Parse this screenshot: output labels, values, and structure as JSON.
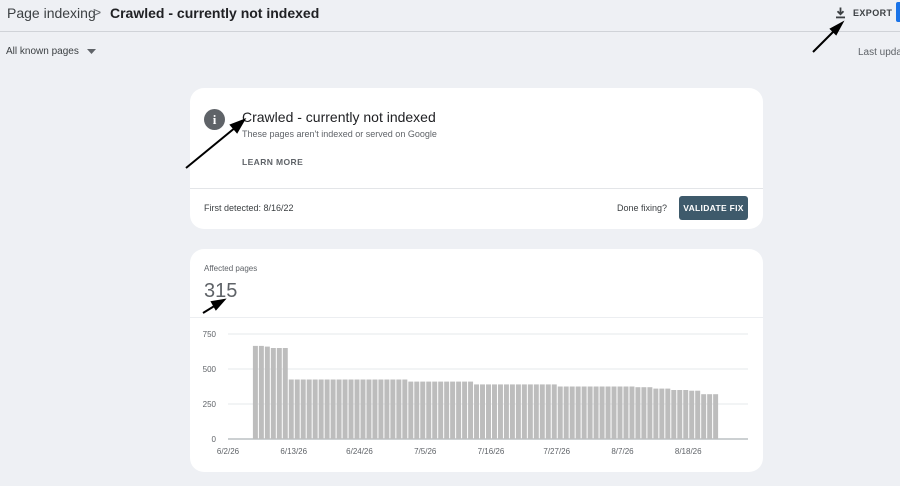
{
  "breadcrumb": {
    "parent": "Page indexing",
    "separator": ">",
    "current": "Crawled - currently not indexed"
  },
  "toolbar": {
    "export_label": "EXPORT",
    "export_icon": "download-icon",
    "last_updated_label": "Last upda"
  },
  "filter": {
    "selected": "All known pages",
    "icon": "dropdown-triangle-icon"
  },
  "status_card": {
    "icon": "info-icon",
    "title": "Crawled - currently not indexed",
    "subtitle": "These pages aren't indexed or served on Google",
    "learn_more_label": "LEARN MORE",
    "first_detected": "First detected: 8/16/22",
    "done_fixing_label": "Done fixing?",
    "validate_label": "VALIDATE FIX"
  },
  "affected_card": {
    "label": "Affected pages",
    "count": "315"
  },
  "colors": {
    "bar": "#bdbdbd",
    "validate_button": "#3e5a6b",
    "accent": "#1a73e8",
    "card": "#ffffff",
    "page_bg": "#eef0f4"
  },
  "chart_data": {
    "type": "bar",
    "ylim": [
      0,
      750
    ],
    "y_ticks": [
      0,
      250,
      500,
      750
    ],
    "x_tick_labels": [
      "6/2/26",
      "6/13/26",
      "6/24/26",
      "7/5/26",
      "7/16/26",
      "7/27/26",
      "8/7/26",
      "8/18/26"
    ],
    "x_tick_dates": [
      "2026-06-02",
      "2026-06-13",
      "2026-06-24",
      "2026-07-05",
      "2026-07-16",
      "2026-07-27",
      "2026-08-07",
      "2026-08-18"
    ],
    "date_start": "2026-06-02",
    "date_end": "2026-08-22",
    "grid": true,
    "series": [
      {
        "points": [
          [
            "2026-06-06",
            665
          ],
          [
            "2026-06-07",
            665
          ],
          [
            "2026-06-08",
            660
          ],
          [
            "2026-06-09",
            650
          ],
          [
            "2026-06-10",
            650
          ],
          [
            "2026-06-11",
            650
          ],
          [
            "2026-06-12",
            425
          ],
          [
            "2026-06-13",
            425
          ],
          [
            "2026-06-14",
            425
          ],
          [
            "2026-06-15",
            425
          ],
          [
            "2026-06-16",
            425
          ],
          [
            "2026-06-17",
            425
          ],
          [
            "2026-06-18",
            425
          ],
          [
            "2026-06-19",
            425
          ],
          [
            "2026-06-20",
            425
          ],
          [
            "2026-06-21",
            425
          ],
          [
            "2026-06-22",
            425
          ],
          [
            "2026-06-23",
            425
          ],
          [
            "2026-06-24",
            425
          ],
          [
            "2026-06-25",
            425
          ],
          [
            "2026-06-26",
            425
          ],
          [
            "2026-06-27",
            425
          ],
          [
            "2026-06-28",
            425
          ],
          [
            "2026-06-29",
            425
          ],
          [
            "2026-06-30",
            425
          ],
          [
            "2026-07-01",
            425
          ],
          [
            "2026-07-02",
            410
          ],
          [
            "2026-07-03",
            410
          ],
          [
            "2026-07-04",
            410
          ],
          [
            "2026-07-05",
            410
          ],
          [
            "2026-07-06",
            410
          ],
          [
            "2026-07-07",
            410
          ],
          [
            "2026-07-08",
            410
          ],
          [
            "2026-07-09",
            410
          ],
          [
            "2026-07-10",
            410
          ],
          [
            "2026-07-11",
            410
          ],
          [
            "2026-07-12",
            410
          ],
          [
            "2026-07-13",
            390
          ],
          [
            "2026-07-14",
            390
          ],
          [
            "2026-07-15",
            390
          ],
          [
            "2026-07-16",
            390
          ],
          [
            "2026-07-17",
            390
          ],
          [
            "2026-07-18",
            390
          ],
          [
            "2026-07-19",
            390
          ],
          [
            "2026-07-20",
            390
          ],
          [
            "2026-07-21",
            390
          ],
          [
            "2026-07-22",
            390
          ],
          [
            "2026-07-23",
            390
          ],
          [
            "2026-07-24",
            390
          ],
          [
            "2026-07-25",
            390
          ],
          [
            "2026-07-26",
            390
          ],
          [
            "2026-07-27",
            375
          ],
          [
            "2026-07-28",
            375
          ],
          [
            "2026-07-29",
            375
          ],
          [
            "2026-07-30",
            375
          ],
          [
            "2026-07-31",
            375
          ],
          [
            "2026-08-01",
            375
          ],
          [
            "2026-08-02",
            375
          ],
          [
            "2026-08-03",
            375
          ],
          [
            "2026-08-04",
            375
          ],
          [
            "2026-08-05",
            375
          ],
          [
            "2026-08-06",
            375
          ],
          [
            "2026-08-07",
            375
          ],
          [
            "2026-08-08",
            375
          ],
          [
            "2026-08-09",
            370
          ],
          [
            "2026-08-10",
            370
          ],
          [
            "2026-08-11",
            370
          ],
          [
            "2026-08-12",
            360
          ],
          [
            "2026-08-13",
            360
          ],
          [
            "2026-08-14",
            360
          ],
          [
            "2026-08-15",
            350
          ],
          [
            "2026-08-16",
            350
          ],
          [
            "2026-08-17",
            350
          ],
          [
            "2026-08-18",
            345
          ],
          [
            "2026-08-19",
            345
          ],
          [
            "2026-08-20",
            320
          ],
          [
            "2026-08-21",
            320
          ],
          [
            "2026-08-22",
            320
          ]
        ]
      }
    ]
  }
}
